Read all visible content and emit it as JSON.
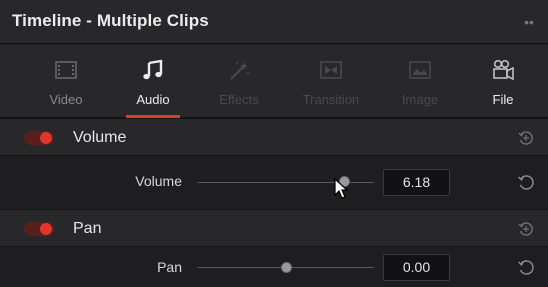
{
  "window": {
    "title": "Timeline - Multiple Clips"
  },
  "tabs": [
    {
      "label": "Video",
      "icon": "film-frame-icon",
      "state": "normal"
    },
    {
      "label": "Audio",
      "icon": "music-note-icon",
      "state": "active"
    },
    {
      "label": "Effects",
      "icon": "magic-wand-icon",
      "state": "disabled"
    },
    {
      "label": "Transition",
      "icon": "transition-icon",
      "state": "disabled"
    },
    {
      "label": "Image",
      "icon": "image-icon",
      "state": "disabled"
    },
    {
      "label": "File",
      "icon": "film-camera-icon",
      "state": "normal"
    }
  ],
  "sections": {
    "volume": {
      "title": "Volume",
      "enabled": true,
      "param_label": "Volume",
      "value": "6.18",
      "slider_fraction": 0.83
    },
    "pan": {
      "title": "Pan",
      "enabled": true,
      "param_label": "Pan",
      "value": "0.00",
      "slider_fraction": 0.5
    }
  },
  "colors": {
    "accent": "#e03a2f",
    "panel": "#28282b",
    "background": "#1e1e20"
  }
}
